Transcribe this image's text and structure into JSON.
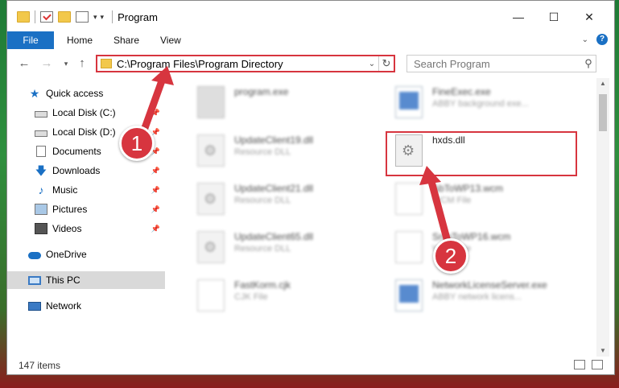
{
  "window": {
    "title": "Program",
    "controls": {
      "minimize": "—",
      "maximize": "☐",
      "close": "✕"
    }
  },
  "ribbon": {
    "tabs": [
      {
        "label": "File"
      },
      {
        "label": "Home"
      },
      {
        "label": "Share"
      },
      {
        "label": "View"
      }
    ]
  },
  "navigation": {
    "address": "C:\\Program Files\\Program Directory",
    "search_placeholder": "Search Program"
  },
  "sidebar": {
    "items": [
      {
        "label": "Quick access"
      },
      {
        "label": "Local Disk (C:)"
      },
      {
        "label": "Local Disk (D:)"
      },
      {
        "label": "Documents"
      },
      {
        "label": "Downloads"
      },
      {
        "label": "Music"
      },
      {
        "label": "Pictures"
      },
      {
        "label": "Videos"
      },
      {
        "label": "OneDrive"
      },
      {
        "label": "This PC"
      },
      {
        "label": "Network"
      }
    ]
  },
  "files": [
    {
      "name": "program.exe",
      "type": ""
    },
    {
      "name": "FineExec.exe",
      "type": "ABBY background exe..."
    },
    {
      "name": "UpdateClient19.dll",
      "type": "Resource DLL"
    },
    {
      "name": "hxds.dll",
      "type": ""
    },
    {
      "name": "UpdateClient21.dll",
      "type": "Resource DLL"
    },
    {
      "name": "AbToWP13.wcm",
      "type": "WCM File"
    },
    {
      "name": "UpdateClient65.dll",
      "type": "Resource DLL"
    },
    {
      "name": "SnipToWP16.wcm",
      "type": "WCM File"
    },
    {
      "name": "FastKorm.cjk",
      "type": "CJK File"
    },
    {
      "name": "NetworkLicenseServer.exe",
      "type": "ABBY network licens..."
    }
  ],
  "status": {
    "item_count": "147 items"
  },
  "callouts": {
    "step1": "1",
    "step2": "2"
  },
  "colors": {
    "accent": "#1a70c4",
    "highlight": "#d7353f"
  }
}
